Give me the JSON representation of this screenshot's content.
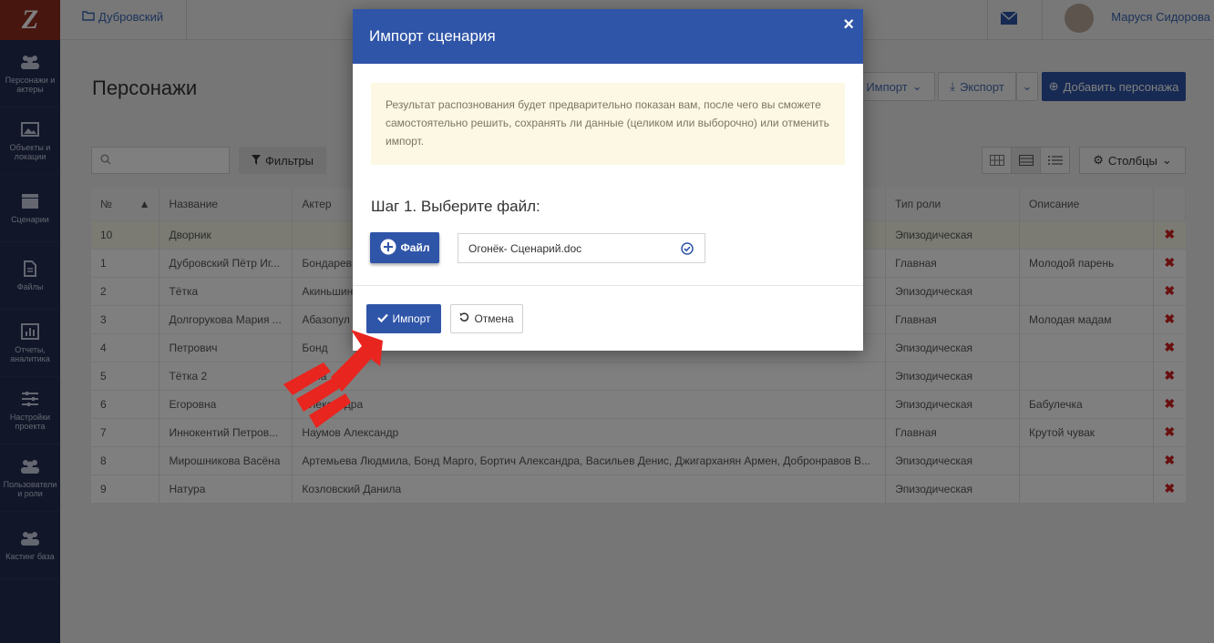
{
  "app": {
    "logo": "Z"
  },
  "sidebar": {
    "items": [
      {
        "label": "Персонажи и актеры",
        "icon": "people-icon"
      },
      {
        "label": "Объекты и локации",
        "icon": "image-icon"
      },
      {
        "label": "Сценарии",
        "icon": "clapperboard-icon"
      },
      {
        "label": "Файлы",
        "icon": "file-icon"
      },
      {
        "label": "Отчеты, аналитика",
        "icon": "chart-icon"
      },
      {
        "label": "Настройки проекта",
        "icon": "sliders-icon"
      },
      {
        "label": "Пользователи и роли",
        "icon": "users-icon"
      },
      {
        "label": "Кастинг база",
        "icon": "people-icon"
      }
    ]
  },
  "topbar": {
    "project": "Дубровский",
    "user": "Маруся Сидорова"
  },
  "page": {
    "title": "Персонажи",
    "import_label": "Импорт",
    "export_label": "Экспорт",
    "add_label": "Добавить персонажа",
    "filters_label": "Фильтры",
    "columns_label": "Столбцы",
    "search_placeholder": ""
  },
  "table": {
    "headers": [
      "№",
      "Название",
      "Актер",
      "Тип роли",
      "Описание"
    ],
    "rows": [
      {
        "num": "10",
        "name": "Дворник",
        "actor": "",
        "role": "Эпизодическая",
        "desc": ""
      },
      {
        "num": "1",
        "name": "Дубровский Пётр Иг...",
        "actor": "Бондарев",
        "role": "Главная",
        "desc": "Молодой парень"
      },
      {
        "num": "2",
        "name": "Тётка",
        "actor": "Акиньшин",
        "role": "Эпизодическая",
        "desc": ""
      },
      {
        "num": "3",
        "name": "Долгорукова Мария ...",
        "actor": "Абазопул",
        "role": "Главная",
        "desc": "Молодая мадам"
      },
      {
        "num": "4",
        "name": "Петрович",
        "actor": "Бонд",
        "role": "Эпизодическая",
        "desc": ""
      },
      {
        "num": "5",
        "name": "Тётка 2",
        "actor": "лана",
        "role": "Эпизодическая",
        "desc": ""
      },
      {
        "num": "6",
        "name": "Егоровна",
        "actor": "Александра",
        "role": "Эпизодическая",
        "desc": "Бабулечка"
      },
      {
        "num": "7",
        "name": "Иннокентий Петров...",
        "actor": "Наумов Александр",
        "role": "Главная",
        "desc": "Крутой чувак"
      },
      {
        "num": "8",
        "name": "Мирошникова Васёна",
        "actor": "Артемьева Людмила, Бонд Марго, Бортич Александра, Васильев Денис, Джигарханян Армен, Добронравов В...",
        "role": "Эпизодическая",
        "desc": ""
      },
      {
        "num": "9",
        "name": "Натура",
        "actor": "Козловский Данила",
        "role": "Эпизодическая",
        "desc": ""
      }
    ]
  },
  "modal": {
    "title": "Импорт сценария",
    "close_label": "×",
    "notice": "Результат распознования будет предварительно показан вам, после чего вы сможете самостоятельно решить, сохранять ли данные (целиком или выборочно) или отменить импорт.",
    "step_label": "Шаг 1. Выберите файл:",
    "file_button": "Файл",
    "file_name": "Огонёк- Сценарий.doc",
    "import_button": "Импорт",
    "cancel_button": "Отмена"
  },
  "colors": {
    "primary": "#2f55a8",
    "sidebar": "#222c52",
    "danger": "#d32020",
    "notice_bg": "#fcf8e3",
    "arrow": "#e8251f"
  }
}
